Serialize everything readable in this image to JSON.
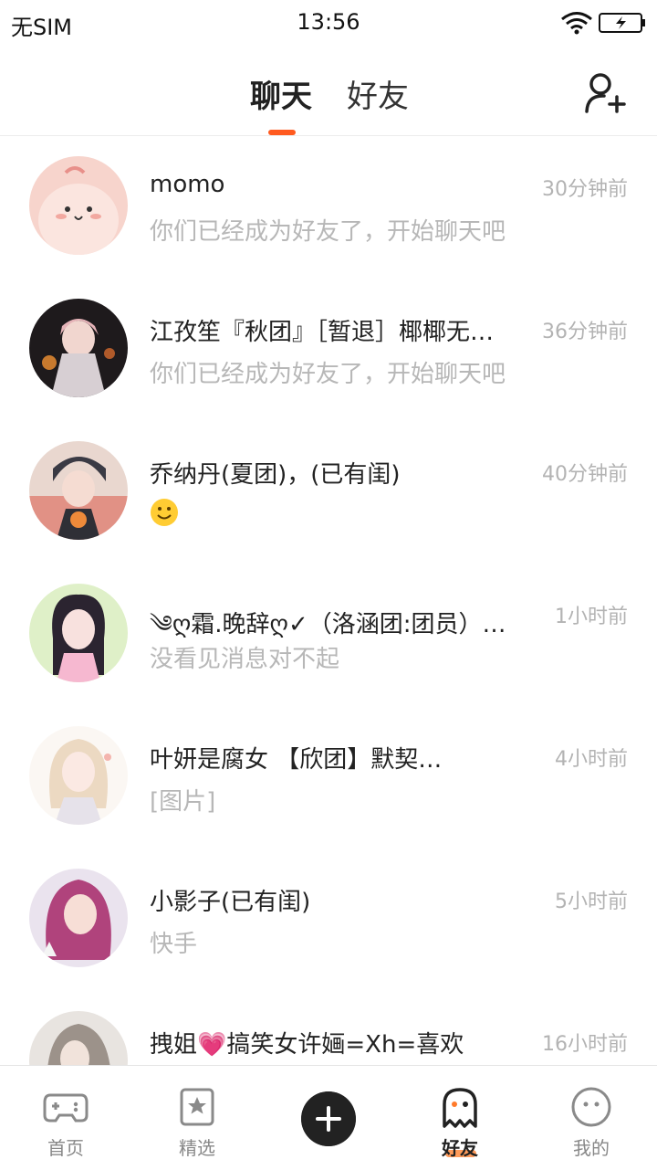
{
  "status_bar": {
    "carrier": "无SIM",
    "time": "13:56"
  },
  "header": {
    "tabs": [
      {
        "label": "聊天",
        "active": true
      },
      {
        "label": "好友",
        "active": false
      }
    ],
    "accent_color": "#ff5a1f"
  },
  "chats": [
    {
      "name": "momo",
      "time": "30分钟前",
      "message": "你们已经成为好友了，开始聊天吧"
    },
    {
      "name": "江孜笙『秋团』［暂退］椰椰无…",
      "time": "36分钟前",
      "message": "你们已经成为好友了，开始聊天吧"
    },
    {
      "name": "乔纳丹(夏团)，(已有闺)",
      "time": "40分钟前",
      "message": "",
      "message_icon": "smile-emoji"
    },
    {
      "name": "༄ღ霜.晚辞ღ✓（洛涵团:团员）…",
      "time": "1小时前",
      "message": "没看见消息对不起"
    },
    {
      "name": "叶妍是腐女 【欣团】默契…",
      "time": "4小时前",
      "message": "[图片]"
    },
    {
      "name": "小影子(已有闺)",
      "time": "5小时前",
      "message": "快手"
    },
    {
      "name": "拽姐💗搞笑女许婳=Xh=喜欢",
      "time": "16小时前",
      "message": ""
    }
  ],
  "bottom_nav": [
    {
      "label": "首页",
      "icon": "gamepad-icon"
    },
    {
      "label": "精选",
      "icon": "star-bookmark-icon"
    },
    {
      "label": "",
      "icon": "plus-icon"
    },
    {
      "label": "好友",
      "icon": "ghost-icon",
      "active": true
    },
    {
      "label": "我的",
      "icon": "face-icon"
    }
  ]
}
